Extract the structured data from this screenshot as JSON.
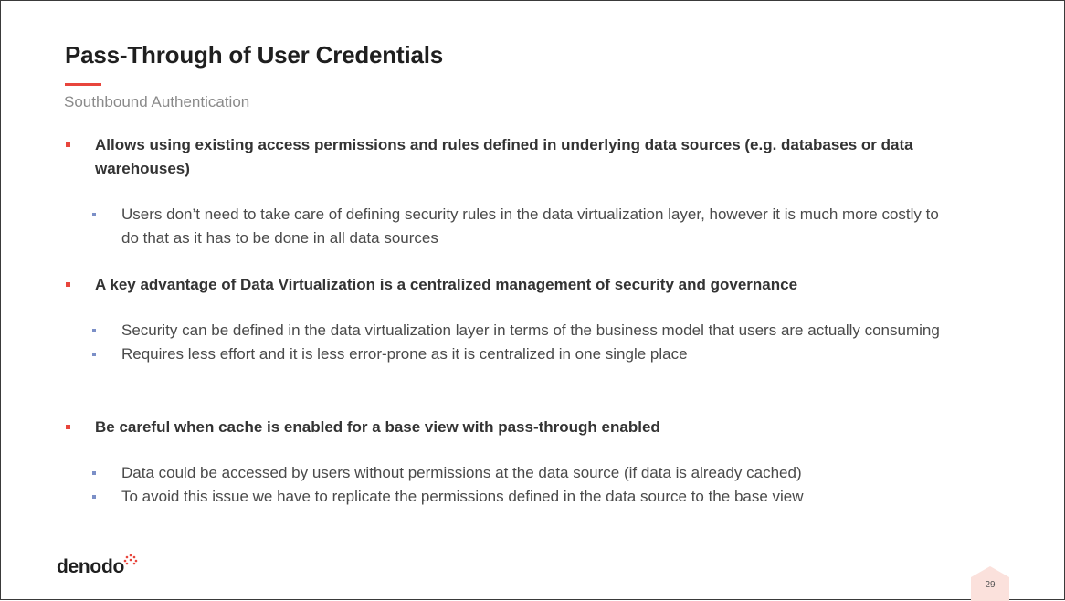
{
  "slide": {
    "title": "Pass-Through of User Credentials",
    "subtitle": "Southbound Authentication",
    "page_number": "29",
    "logo_text": "denodo",
    "accent_color": "#e8453c",
    "sub_bullet_color": "#7b8fc7"
  },
  "bullets": [
    {
      "text": "Allows using existing access permissions and rules defined in underlying data sources (e.g. databases or data warehouses)",
      "sub": [
        "Users don’t need to take care of defining security rules in the data virtualization layer, however it is much more costly to do that as it has to be done in all data sources"
      ]
    },
    {
      "text": "A key advantage of Data Virtualization is a centralized management of security and governance",
      "sub": [
        "Security can be defined in the data virtualization layer in terms of the business model that users are actually consuming",
        "Requires less effort and it is less error-prone as it is centralized in one single place"
      ]
    },
    {
      "text": "Be careful when cache is enabled for a base view with pass-through enabled",
      "sub": [
        "Data could be accessed by users without permissions at the data source (if data is already cached)",
        "To avoid this issue we have to replicate the permissions defined in the data source to the base view"
      ]
    }
  ]
}
